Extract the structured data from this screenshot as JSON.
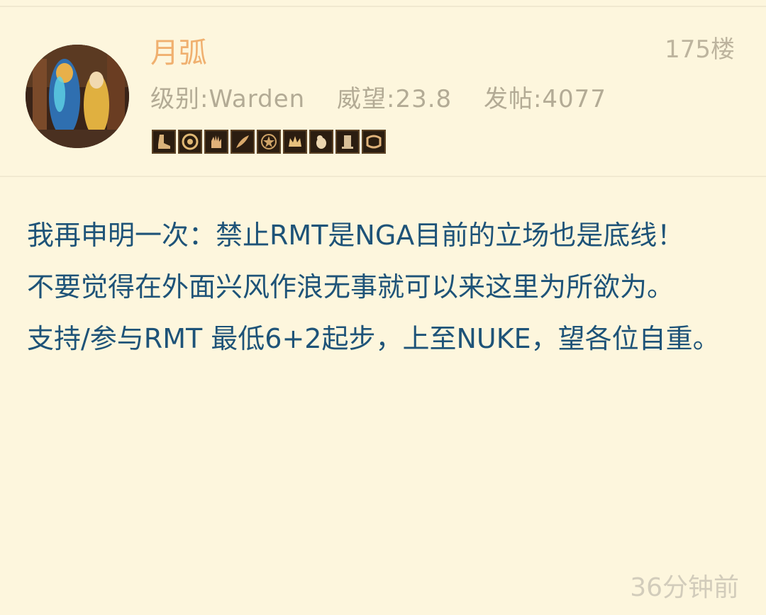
{
  "post": {
    "username": "月弧",
    "floor": "175楼",
    "level": "级别:Warden",
    "reputation": "威望:23.8",
    "posts": "发帖:4077",
    "badges": [
      "boot-badge-icon",
      "spiral-badge-icon",
      "hand-badge-icon",
      "feather-badge-icon",
      "star-badge-icon",
      "crown-badge-icon",
      "bird-badge-icon",
      "lamp-badge-icon",
      "scroll-badge-icon"
    ],
    "content": {
      "line1": "我再申明一次：禁止RMT是NGA目前的立场也是底线！",
      "line2": "不要觉得在外面兴风作浪无事就可以来这里为所欲为。",
      "line3": "支持/参与RMT 最低6+2起步，上至NUKE，望各位自重。"
    },
    "timestamp": "36分钟前"
  },
  "colors": {
    "background": "#fdf6dd",
    "username": "#f0b06f",
    "meta": "#b3ab95",
    "content": "#1e5378",
    "badge_frame": "#5a4124"
  }
}
